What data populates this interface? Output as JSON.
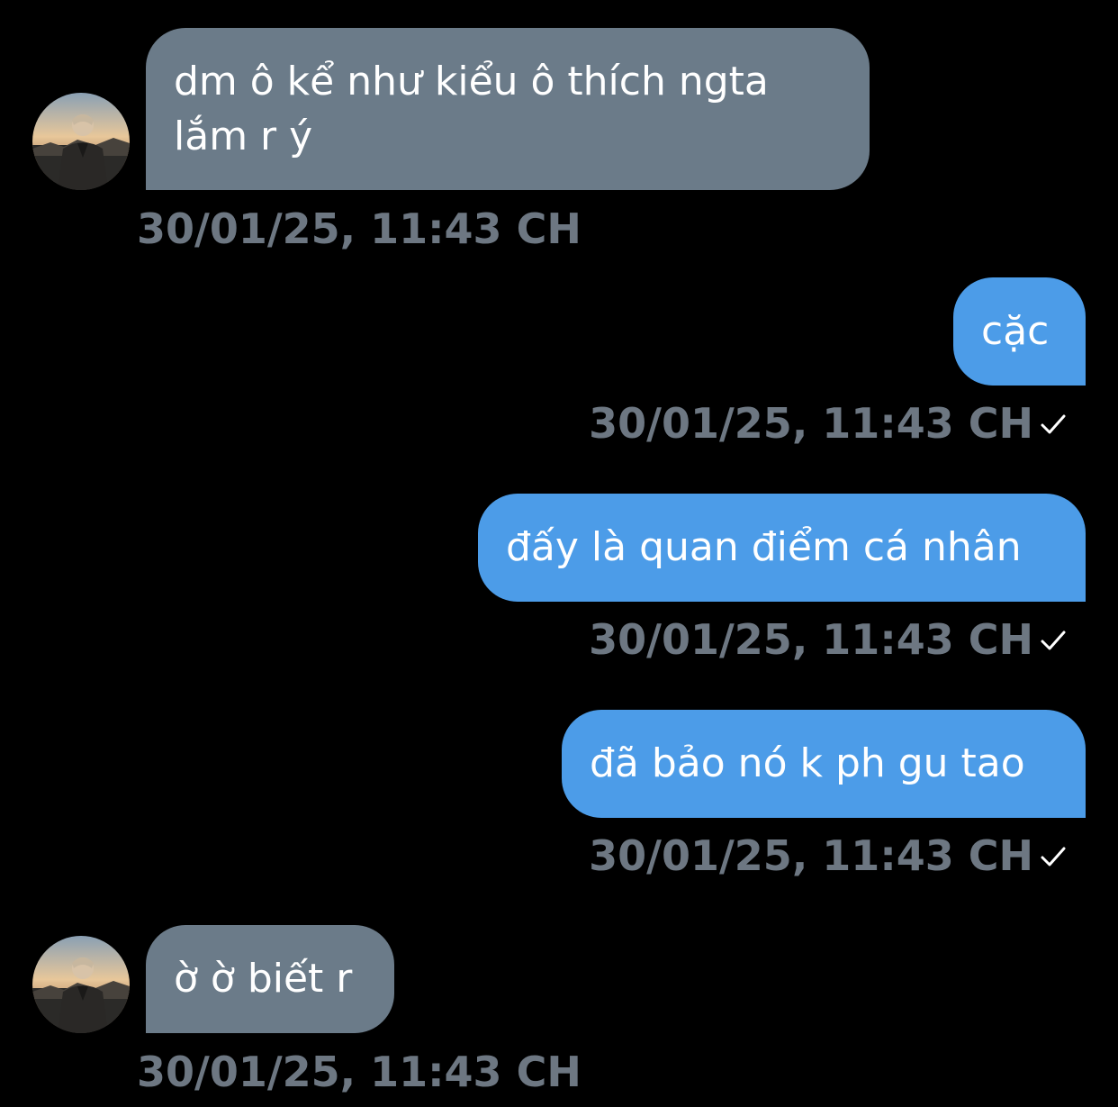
{
  "messages": [
    {
      "direction": "incoming",
      "lines": [
        "dm ô kể như kiểu ô thích ngta",
        "lắm r ý"
      ],
      "timestamp": "30/01/25, 11:43 CH",
      "has_avatar": true
    },
    {
      "direction": "outgoing",
      "lines": [
        "cặc"
      ],
      "timestamp": "30/01/25, 11:43 CH",
      "status_icon": "checkmark-icon"
    },
    {
      "direction": "outgoing",
      "lines": [
        "đấy là quan điểm cá nhân"
      ],
      "timestamp": "30/01/25, 11:43 CH",
      "status_icon": "checkmark-icon"
    },
    {
      "direction": "outgoing",
      "lines": [
        "đã bảo nó k ph gu tao"
      ],
      "timestamp": "30/01/25, 11:43 CH",
      "status_icon": "checkmark-icon"
    },
    {
      "direction": "incoming",
      "lines": [
        "ờ ờ biết r"
      ],
      "timestamp": "30/01/25, 11:43 CH",
      "has_avatar": true
    }
  ],
  "colors": {
    "background": "#000000",
    "incoming_bubble": "#6b7b89",
    "outgoing_bubble": "#4c9ce8",
    "timestamp": "#6d7782",
    "text": "#ffffff"
  }
}
